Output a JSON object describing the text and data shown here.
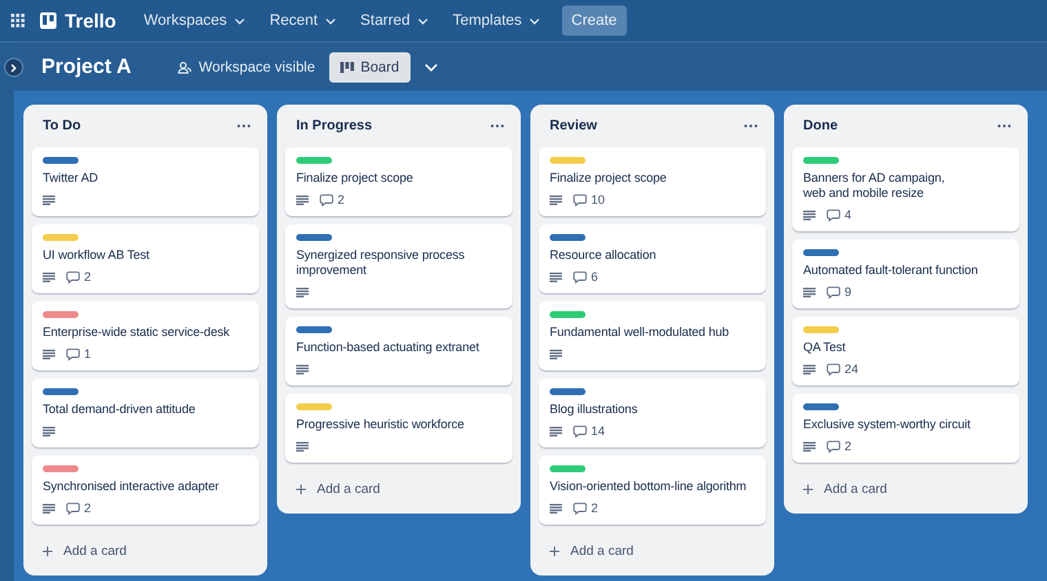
{
  "nav": {
    "brand": "Trello",
    "menus": [
      "Workspaces",
      "Recent",
      "Starred",
      "Templates"
    ],
    "create": "Create"
  },
  "board": {
    "title": "Project A",
    "visibility": "Workspace visible",
    "view": "Board"
  },
  "lists": [
    {
      "title": "To Do",
      "add": "Add a card",
      "cards": [
        {
          "title": "Twitter AD",
          "color": "#2f6fb3"
        },
        {
          "title": "UI workflow AB Test",
          "color": "#f2cd4a",
          "comments": "2"
        },
        {
          "title": "Enterprise-wide static service-desk",
          "color": "#ee8a8c",
          "comments": "1"
        },
        {
          "title": "Total demand-driven attitude",
          "color": "#2f6fb3"
        },
        {
          "title": "Synchronised interactive adapter",
          "color": "#ee8a8c",
          "comments": "2"
        }
      ]
    },
    {
      "title": "In Progress",
      "add": "Add a card",
      "cards": [
        {
          "title": "Finalize project scope",
          "color": "#2ecc78",
          "comments": "2"
        },
        {
          "title": "Synergized responsive process improvement",
          "color": "#2f6fb3"
        },
        {
          "title": "Function-based actuating extranet",
          "color": "#2f6fb3"
        },
        {
          "title": "Progressive heuristic workforce",
          "color": "#f2cd4a"
        }
      ]
    },
    {
      "title": "Review",
      "add": "Add a card",
      "cards": [
        {
          "title": "Finalize project scope",
          "color": "#f2cd4a",
          "comments": "10"
        },
        {
          "title": "Resource allocation",
          "color": "#2f6fb3",
          "comments": "6"
        },
        {
          "title": "Fundamental well-modulated hub",
          "color": "#2ecc78"
        },
        {
          "title": "Blog illustrations",
          "color": "#2f6fb3",
          "comments": "14"
        },
        {
          "title": "Vision-oriented bottom-line algorithm",
          "color": "#2ecc78",
          "comments": "2"
        }
      ]
    },
    {
      "title": "Done",
      "add": "Add a card",
      "cards": [
        {
          "title": "Banners for AD campaign,\nweb and mobile resize",
          "color": "#2ecc78",
          "comments": "4"
        },
        {
          "title": "Automated fault-tolerant function",
          "color": "#2f6fb3",
          "comments": "9"
        },
        {
          "title": "QA Test",
          "color": "#f2cd4a",
          "comments": "24"
        },
        {
          "title": "Exclusive system-worthy circuit",
          "color": "#2f6fb3",
          "comments": "2"
        }
      ]
    }
  ]
}
